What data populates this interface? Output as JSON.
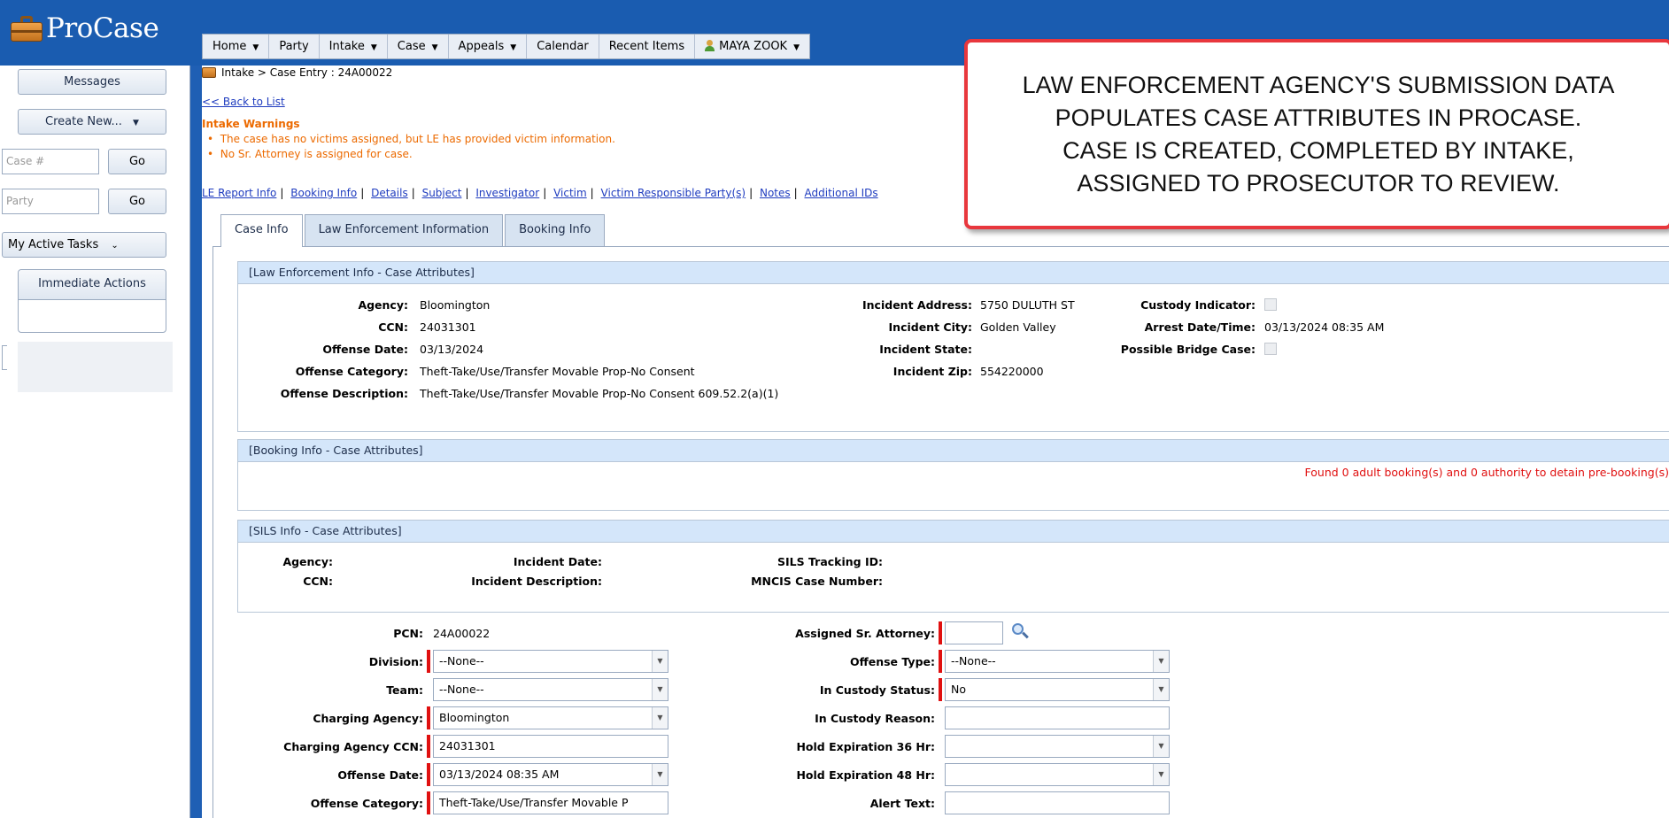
{
  "app": {
    "logo_text": "ProCase"
  },
  "nav": {
    "items": [
      {
        "label": "Home",
        "dropdown": true
      },
      {
        "label": "Party",
        "dropdown": false
      },
      {
        "label": "Intake",
        "dropdown": true
      },
      {
        "label": "Case",
        "dropdown": true
      },
      {
        "label": "Appeals",
        "dropdown": true
      },
      {
        "label": "Calendar",
        "dropdown": false
      },
      {
        "label": "Recent Items",
        "dropdown": false
      }
    ],
    "user": "MAYA ZOOK"
  },
  "sidebar": {
    "messages": "Messages",
    "create_new": "Create New...",
    "case_placeholder": "Case #",
    "party_placeholder": "Party",
    "go": "Go",
    "tasks": "My Active Tasks",
    "immediate_actions": "Immediate Actions"
  },
  "breadcrumb": "Intake > Case Entry : 24A00022",
  "back_link": "<< Back to List",
  "warnings": {
    "title": "Intake Warnings",
    "items": [
      "The case has no victims assigned, but LE has provided victim information.",
      "No Sr. Attorney is assigned for case."
    ]
  },
  "sublinks": [
    "LE Report Info",
    "Booking Info",
    "Details",
    "Subject",
    "Investigator",
    "Victim",
    "Victim Responsible Party(s)",
    "Notes",
    "Additional IDs"
  ],
  "tabs": [
    "Case Info",
    "Law Enforcement Information",
    "Booking Info"
  ],
  "le_section": {
    "title": "[Law Enforcement Info - Case Attributes]",
    "agency_label": "Agency:",
    "agency": "Bloomington",
    "ccn_label": "CCN:",
    "ccn": "24031301",
    "offense_date_label": "Offense Date:",
    "offense_date": "03/13/2024",
    "offense_category_label": "Offense Category:",
    "offense_category": "Theft-Take/Use/Transfer Movable Prop-No Consent",
    "offense_desc_label": "Offense Description:",
    "offense_desc": "Theft-Take/Use/Transfer Movable Prop-No Consent 609.52.2(a)(1)",
    "incident_address_label": "Incident Address:",
    "incident_address": "5750 DULUTH ST",
    "incident_city_label": "Incident City:",
    "incident_city": "Golden Valley",
    "incident_state_label": "Incident State:",
    "incident_zip_label": "Incident Zip:",
    "incident_zip": "554220000",
    "custody_label": "Custody Indicator:",
    "arrest_label": "Arrest Date/Time:",
    "arrest": "03/13/2024 08:35 AM",
    "bridge_label": "Possible Bridge Case:"
  },
  "booking_section": {
    "title": "[Booking Info - Case Attributes]",
    "message": "Found 0 adult booking(s) and 0 authority to detain pre-booking(s)"
  },
  "sils_section": {
    "title": "[SILS Info - Case Attributes]",
    "agency_label": "Agency:",
    "ccn_label": "CCN:",
    "incident_date_label": "Incident Date:",
    "incident_desc_label": "Incident Description:",
    "tracking_label": "SILS Tracking ID:",
    "mncis_label": "MNCIS Case Number:"
  },
  "form": {
    "pcn_label": "PCN:",
    "pcn": "24A00022",
    "division_label": "Division:",
    "division": "--None--",
    "team_label": "Team:",
    "team": "--None--",
    "charging_agency_label": "Charging Agency:",
    "charging_agency": "Bloomington",
    "charging_ccn_label": "Charging Agency CCN:",
    "charging_ccn": "24031301",
    "offense_date_label": "Offense Date:",
    "offense_date": "03/13/2024 08:35 AM",
    "offense_category_label": "Offense Category:",
    "offense_category": "Theft-Take/Use/Transfer Movable P",
    "sr_attorney_label": "Assigned Sr. Attorney:",
    "sr_attorney": "",
    "offense_type_label": "Offense Type:",
    "offense_type": "--None--",
    "custody_status_label": "In Custody Status:",
    "custody_status": "No",
    "custody_reason_label": "In Custody Reason:",
    "custody_reason": "",
    "hold36_label": "Hold Expiration 36 Hr:",
    "hold36": "",
    "hold48_label": "Hold Expiration 48 Hr:",
    "hold48": "",
    "alert_label": "Alert Text:",
    "alert": ""
  },
  "callout": {
    "line1": "LAW ENFORCEMENT AGENCY'S SUBMISSION DATA",
    "line2": "POPULATES CASE ATTRIBUTES IN PROCASE.",
    "line3": "CASE IS CREATED, COMPLETED BY INTAKE,",
    "line4": "ASSIGNED TO PROSECUTOR TO REVIEW."
  }
}
